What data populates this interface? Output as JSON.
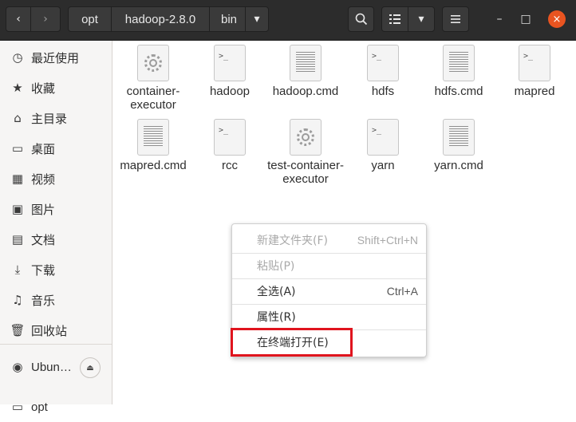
{
  "header": {
    "back_icon": "‹",
    "forward_icon": "›",
    "breadcrumbs": [
      "opt",
      "hadoop-2.8.0",
      "bin"
    ],
    "dropdown_icon": "▾",
    "search_icon": "⚲",
    "view_icon": "☰",
    "menu_icon": "≡",
    "minimize_icon": "–",
    "maximize_icon": "□",
    "close_icon": "×",
    "close_color": "#e95420"
  },
  "sidebar": {
    "items": [
      {
        "label": "最近使用",
        "icon": "clock-icon",
        "glyph": "◷"
      },
      {
        "label": "收藏",
        "icon": "star-icon",
        "glyph": "★"
      },
      {
        "label": "主目录",
        "icon": "home-icon",
        "glyph": "⌂"
      },
      {
        "label": "桌面",
        "icon": "desktop-icon",
        "glyph": "▭"
      },
      {
        "label": "视频",
        "icon": "video-icon",
        "glyph": "▦"
      },
      {
        "label": "图片",
        "icon": "picture-icon",
        "glyph": "▣"
      },
      {
        "label": "文档",
        "icon": "document-icon",
        "glyph": "▤"
      },
      {
        "label": "下载",
        "icon": "download-icon",
        "glyph": "⤓"
      },
      {
        "label": "音乐",
        "icon": "music-icon",
        "glyph": "♫"
      },
      {
        "label": "回收站",
        "icon": "trash-icon",
        "glyph": "🗑"
      }
    ],
    "device": {
      "label": "Ubun…",
      "icon": "disc-icon",
      "glyph": "◉",
      "eject_glyph": "⏏"
    },
    "bottom_partial": {
      "label": "opt",
      "glyph": "▭"
    }
  },
  "files": [
    {
      "name": "container-executor",
      "kind": "exec"
    },
    {
      "name": "hadoop",
      "kind": "script",
      "glyph": ">_"
    },
    {
      "name": "hadoop.cmd",
      "kind": "text"
    },
    {
      "name": "hdfs",
      "kind": "script",
      "glyph": ">_"
    },
    {
      "name": "hdfs.cmd",
      "kind": "text"
    },
    {
      "name": "mapred",
      "kind": "script",
      "glyph": ">_"
    },
    {
      "name": "mapred.cmd",
      "kind": "text"
    },
    {
      "name": "rcc",
      "kind": "script",
      "glyph": ">_"
    },
    {
      "name": "test-container-executor",
      "kind": "exec"
    },
    {
      "name": "yarn",
      "kind": "script",
      "glyph": ">_"
    },
    {
      "name": "yarn.cmd",
      "kind": "text"
    }
  ],
  "context_menu": {
    "items": [
      {
        "label": "新建文件夹(F)",
        "accel": "Shift+Ctrl+N",
        "enabled": false
      },
      {
        "label": "粘贴(P)",
        "accel": "",
        "enabled": false
      },
      {
        "label": "全选(A)",
        "accel": "Ctrl+A",
        "enabled": true
      },
      {
        "label": "属性(R)",
        "accel": "",
        "enabled": true
      },
      {
        "label": "在终端打开(E)",
        "accel": "",
        "enabled": true
      }
    ],
    "highlight_color": "#e0141e"
  }
}
